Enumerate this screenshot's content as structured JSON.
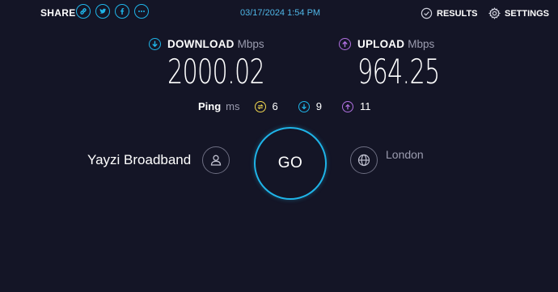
{
  "share": {
    "label": "SHARE",
    "icons": [
      "link-icon",
      "twitter-icon",
      "facebook-icon",
      "more-icon"
    ]
  },
  "timestamp": "03/17/2024 1:54 PM",
  "nav": {
    "results_label": "RESULTS",
    "settings_label": "SETTINGS"
  },
  "download": {
    "label": "DOWNLOAD",
    "unit": "Mbps",
    "value": "2000.02",
    "color": "#1fb4e8"
  },
  "upload": {
    "label": "UPLOAD",
    "unit": "Mbps",
    "value": "964.25",
    "color": "#b070e0"
  },
  "ping": {
    "label": "Ping",
    "unit": "ms",
    "idle": "6",
    "download": "9",
    "upload": "11",
    "idle_color": "#f1d74f"
  },
  "go_label": "GO",
  "provider": {
    "name": "Yayzi Broadband"
  },
  "server": {
    "name": "London"
  },
  "colors": {
    "background": "#141526",
    "accent": "#1fb4e8"
  }
}
